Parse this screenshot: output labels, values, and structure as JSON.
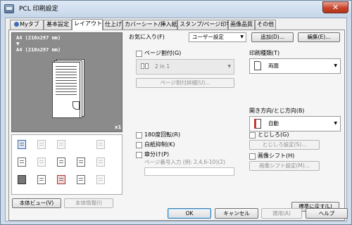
{
  "window": {
    "title": "PCL 印刷設定",
    "close_label": "✕"
  },
  "tabs": [
    {
      "label": "Myタブ"
    },
    {
      "label": "基本設定"
    },
    {
      "label": "レイアウト"
    },
    {
      "label": "仕上げ"
    },
    {
      "label": "カバーシート/挿入紙"
    },
    {
      "label": "スタンプ/ページ印字"
    },
    {
      "label": "画像品質"
    },
    {
      "label": "その他"
    }
  ],
  "preview": {
    "paper_line1": "A4 (210x297 mm)",
    "arrow": "▼",
    "paper_line2": "A4 (210x297 mm)",
    "copies": "x1"
  },
  "left_buttons": {
    "printer_view": "本体ビュー(V)",
    "printer_info": "本体情報(I)"
  },
  "favorites": {
    "label": "お気に入り(F)",
    "value": "ユーザー設定",
    "add": "追加(D)...",
    "edit": "編集(E)..."
  },
  "layout": {
    "combination_label": "ページ割付(G)",
    "combination_value": "2 in 1",
    "combination_details": "ページ割付詳細(U)...",
    "rotate180_label": "180度回転(R)",
    "skip_blank_label": "白紙抑制(K)",
    "chapter_label": "章分け(P)",
    "chapter_hint": "ページ番号入力 (例: 2,4,6-10)(2)",
    "chapter_value": ""
  },
  "print_type": {
    "label": "印刷種類(T)",
    "value": "両面"
  },
  "binding": {
    "label": "開き方向/とじ方向(B)",
    "value": "自動"
  },
  "binding_margin": {
    "label": "とじしろ(G)",
    "button": "とじしろ設定(S)..."
  },
  "image_shift": {
    "label": "画像シフト(H)",
    "button": "画像シフト設定(M)..."
  },
  "defaults_button": "標準に戻す(L)",
  "dialog_buttons": {
    "ok": "OK",
    "cancel": "キャンセル",
    "apply": "適用(A)",
    "help": "ヘルプ"
  }
}
